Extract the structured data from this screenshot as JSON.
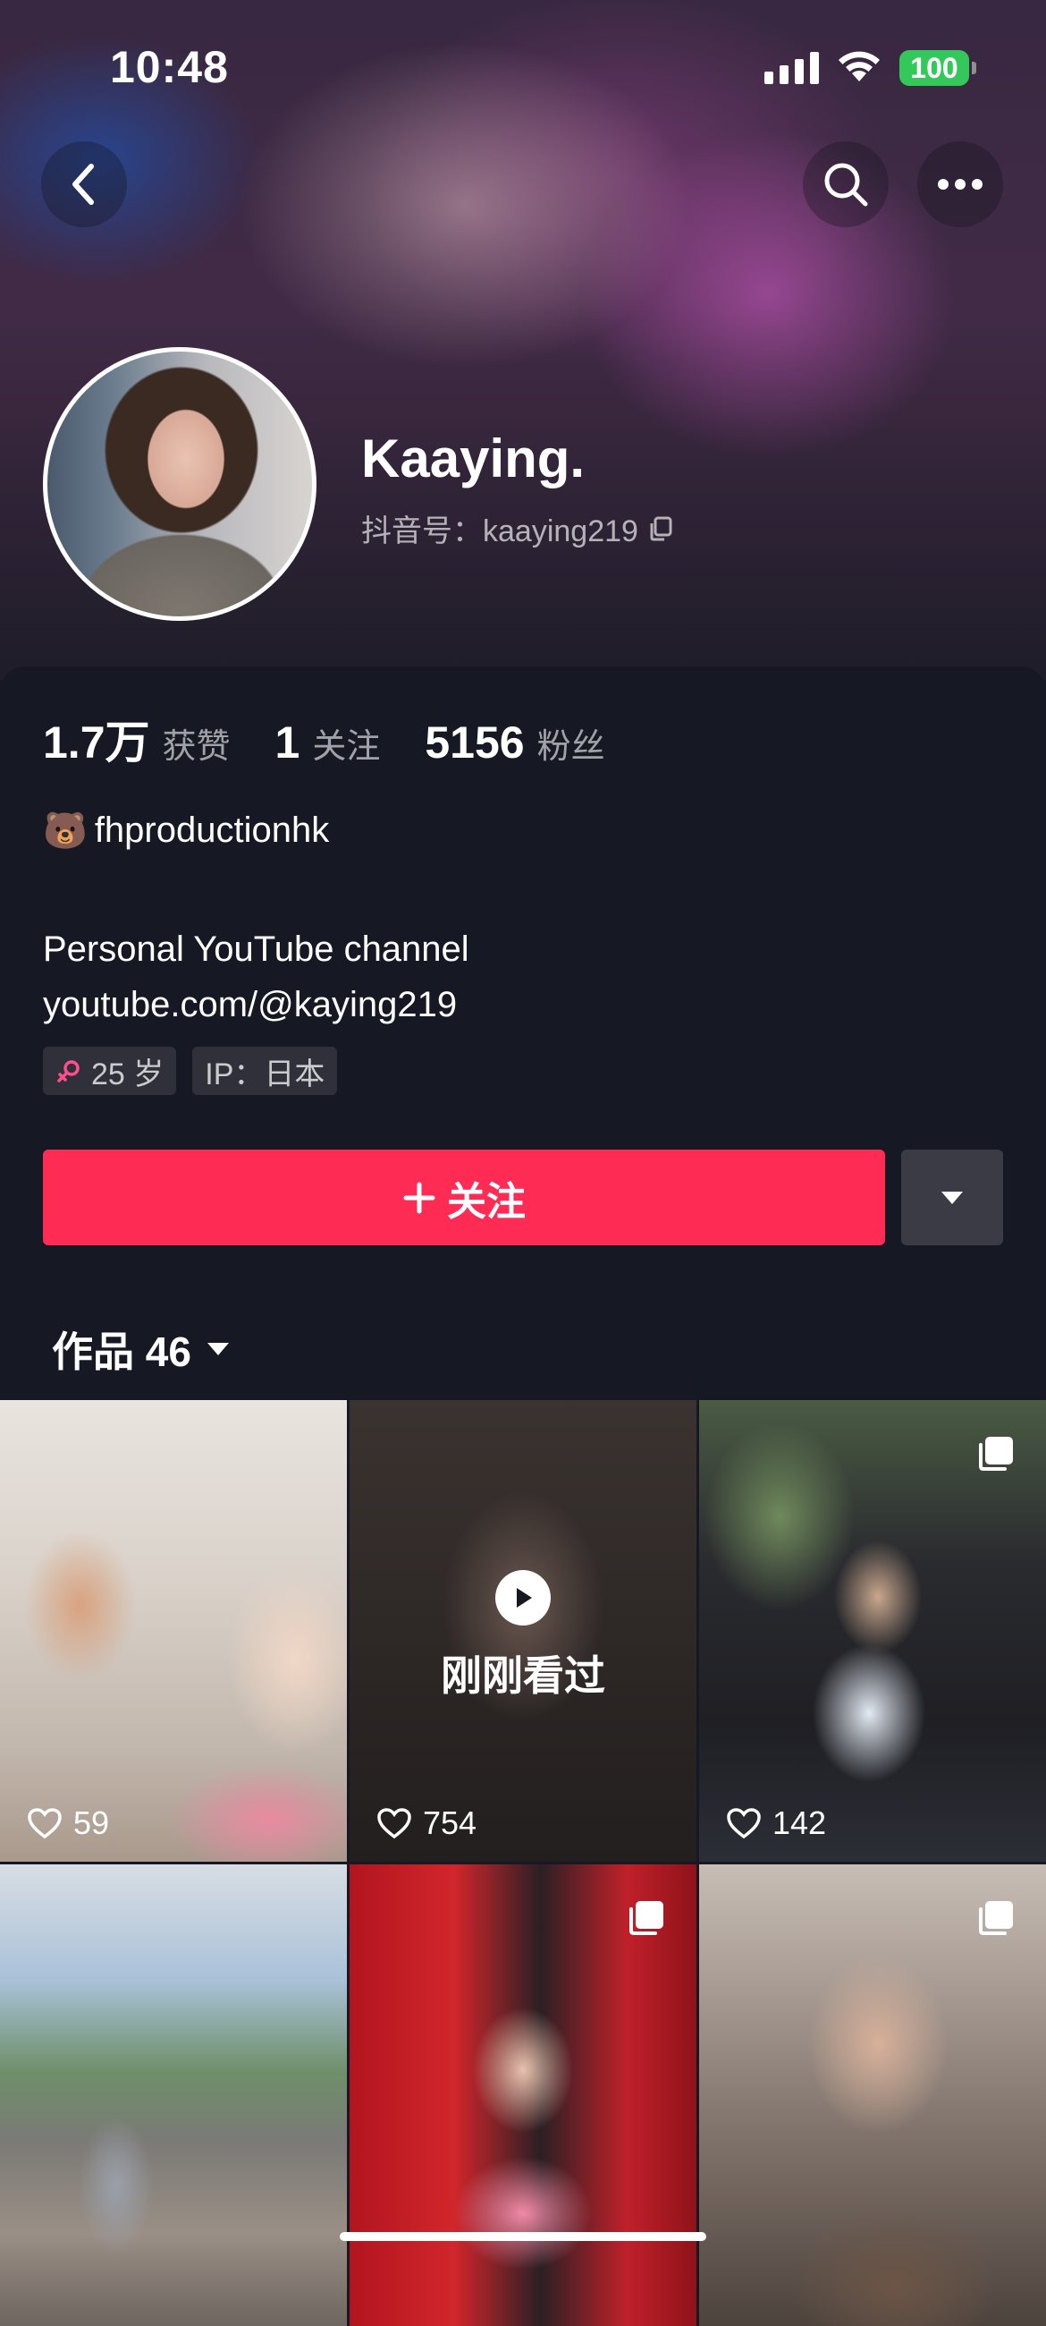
{
  "status_bar": {
    "time": "10:48",
    "battery": "100"
  },
  "profile": {
    "name": "Kaaying.",
    "douyin_id": "抖音号：kaaying219",
    "stats": [
      {
        "value": "1.7万",
        "label": "获赞"
      },
      {
        "value": "1",
        "label": "关注"
      },
      {
        "value": "5156",
        "label": "粉丝"
      }
    ],
    "tagline_emoji": "🐻",
    "tagline": "fhproductionhk",
    "bio_line1": "Personal YouTube channel",
    "bio_line2": "youtube.com/@kaying219",
    "chips": {
      "age": "25 岁",
      "ip": "IP：日本"
    },
    "follow_label": "关注"
  },
  "works": {
    "tab_label": "作品 46",
    "watched_label": "刚刚看过",
    "items": [
      {
        "likes": "59",
        "multi": false
      },
      {
        "likes": "754",
        "multi": false,
        "watched": true
      },
      {
        "likes": "142",
        "multi": true
      },
      {
        "likes": "",
        "multi": false
      },
      {
        "likes": "",
        "multi": true
      },
      {
        "likes": "",
        "multi": true
      }
    ]
  },
  "colors": {
    "accent": "#fe2c55",
    "background": "#161823",
    "battery": "#34c759"
  }
}
